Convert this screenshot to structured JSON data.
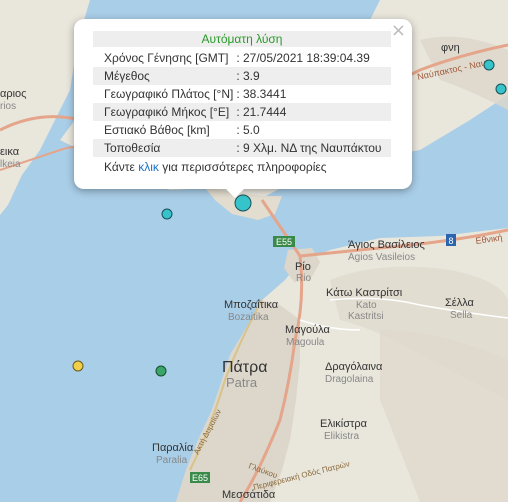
{
  "popup": {
    "title": "Αυτόματη λύση",
    "close": "×",
    "rows": [
      {
        "key": "Χρόνος Γένησης [GMT]",
        "value": ": 27/05/2021 18:39:04.39"
      },
      {
        "key": "Μέγεθος",
        "value": ": 3.9"
      },
      {
        "key": "Γεωγραφικό Πλάτος [°N]",
        "value": ": 38.3441"
      },
      {
        "key": "Γεωγραφικό Μήκος [°E]",
        "value": ": 21.7444"
      },
      {
        "key": "Εστιακό Βάθος [km]",
        "value": ": 5.0"
      },
      {
        "key": "Τοποθεσία",
        "value": ": 9 Χλμ. ΝΔ της Ναυπάκτου"
      }
    ],
    "more_before": "Κάντε ",
    "more_link": "κλικ",
    "more_after": " για περισσότερες πληροφορίες"
  },
  "places": {
    "antirrio_partial": "φνη",
    "nafpaktos_road_partial": "Ναύπακτος - Ναυπ",
    "left_top_partial": "αριος",
    "left_top_partial_latin": "rios",
    "left_mid_partial": "εικα",
    "left_mid_partial_latin": "lkeia",
    "agios_vasileios": "Άγιος Βασίλειος",
    "agios_vasileios_latin": "Agios Vasileios",
    "rio": "Ρίο",
    "rio_latin": "Rio",
    "kato_kastritsi": "Κάτω Καστρίτσι",
    "kato_kastritsi_latin1": "Kato",
    "kato_kastritsi_latin2": "Kastritsi",
    "sella": "Σέλλα",
    "sella_latin": "Sella",
    "bozaitika": "Μποζαΐτικα",
    "bozaitika_latin": "Bozaitika",
    "magoula": "Μαγούλα",
    "magoula_latin": "Magoula",
    "patra": "Πάτρα",
    "patra_latin": "Patra",
    "dragolaina": "Δραγόλαινα",
    "dragolaina_latin": "Dragolaina",
    "paralia": "Παραλία",
    "paralia_latin": "Paralia",
    "elikistra": "Ελικίστρα",
    "elikistra_latin": "Elikistra",
    "messatida": "Μεσσάτιδα",
    "ethniki": "Εθνική",
    "glafkou": "Γλαύκου",
    "akti_dymaion": "Ακτή Δυμαίων",
    "perifereiaki": "Περιφερειακή Οδός Πατρών"
  },
  "road_shields": {
    "e55": "E55",
    "e65": "E65",
    "a8": "8"
  },
  "colors": {
    "sea": "#a9cee8",
    "land": "#e9e6dc",
    "urban": "#dcd6cb",
    "highway": "#e5a58a",
    "quake_cyan": "#36c3c9",
    "quake_green": "#3aa56a",
    "quake_yellow": "#f0d04a",
    "popup_title_green": "#2a9a2a",
    "link_blue": "#1a73c8"
  },
  "markers": [
    {
      "type": "selected-earthquake",
      "color": "cyan"
    },
    {
      "type": "earthquake",
      "color": "cyan"
    },
    {
      "type": "earthquake",
      "color": "cyan"
    },
    {
      "type": "earthquake",
      "color": "cyan"
    },
    {
      "type": "earthquake",
      "color": "green"
    },
    {
      "type": "earthquake",
      "color": "yellow"
    }
  ]
}
